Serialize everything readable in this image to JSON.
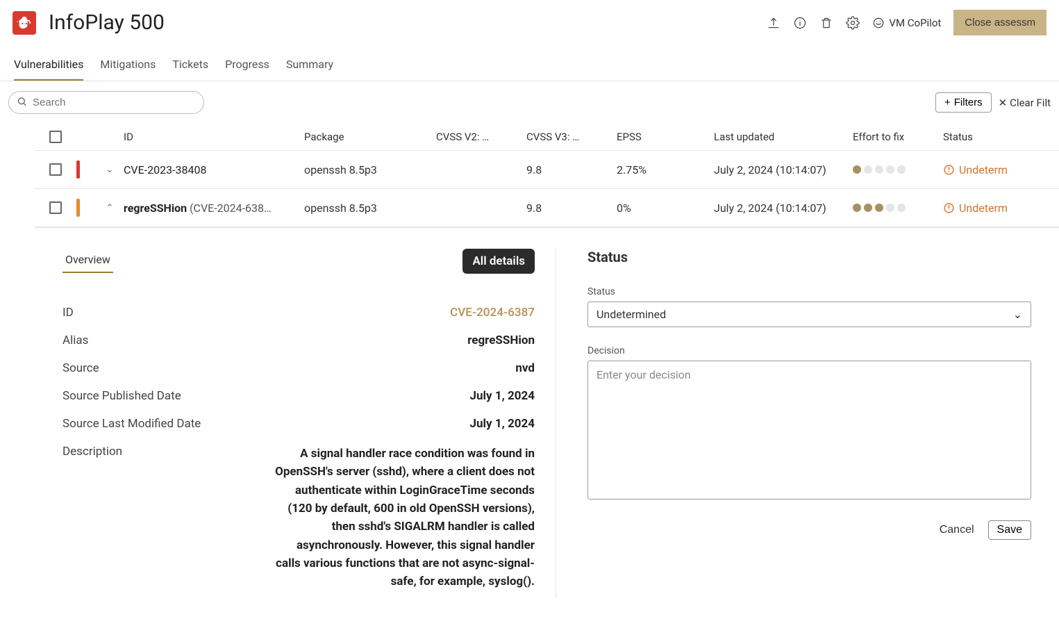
{
  "header": {
    "title": "InfoPlay 500",
    "vm_copilot": "VM CoPilot",
    "close": "Close assessm"
  },
  "tabs": [
    "Vulnerabilities",
    "Mitigations",
    "Tickets",
    "Progress",
    "Summary"
  ],
  "search": {
    "placeholder": "Search"
  },
  "filters": {
    "filters_label": "Filters",
    "clear_label": "Clear Filt"
  },
  "columns": {
    "id": "ID",
    "package": "Package",
    "cvss2": "CVSS V2: …",
    "cvss3": "CVSS V3: …",
    "epss": "EPSS",
    "updated": "Last updated",
    "effort": "Effort to fix",
    "status": "Status"
  },
  "rows": [
    {
      "sev_color": "#d83a2f",
      "expanded": false,
      "id_bold": "",
      "id_text": "CVE-2023-38408",
      "package": "openssh 8.5p3",
      "cvss2": "",
      "cvss3": "9.8",
      "epss": "2.75%",
      "updated": "July 2, 2024 (10:14:07)",
      "effort": 1,
      "status": "Undeterm"
    },
    {
      "sev_color": "#e68a2e",
      "expanded": true,
      "id_bold": "regreSSHion",
      "id_text": " (CVE-2024-638…",
      "package": "openssh 8.5p3",
      "cvss2": "",
      "cvss3": "9.8",
      "epss": "0%",
      "updated": "July 2, 2024 (10:14:07)",
      "effort": 3,
      "status": "Undeterm"
    }
  ],
  "detail": {
    "overview_tab": "Overview",
    "all_details": "All details",
    "kv": {
      "id_label": "ID",
      "id_value": "CVE-2024-6387",
      "alias_label": "Alias",
      "alias_value": "regreSSHion",
      "source_label": "Source",
      "source_value": "nvd",
      "pub_label": "Source Published Date",
      "pub_value": "July 1, 2024",
      "mod_label": "Source Last Modified Date",
      "mod_value": "July 1, 2024",
      "desc_label": "Description",
      "desc_value": "A signal handler race condition was found in OpenSSH's server (sshd), where a client does not authenticate within LoginGraceTime seconds (120 by default, 600 in old OpenSSH versions), then sshd's SIGALRM handler is called asynchronously. However, this signal handler calls various functions that are not async-signal-safe, for example, syslog()."
    },
    "status": {
      "title": "Status",
      "status_label": "Status",
      "status_value": "Undetermined",
      "decision_label": "Decision",
      "decision_placeholder": "Enter your decision",
      "cancel": "Cancel",
      "save": "Save"
    }
  }
}
